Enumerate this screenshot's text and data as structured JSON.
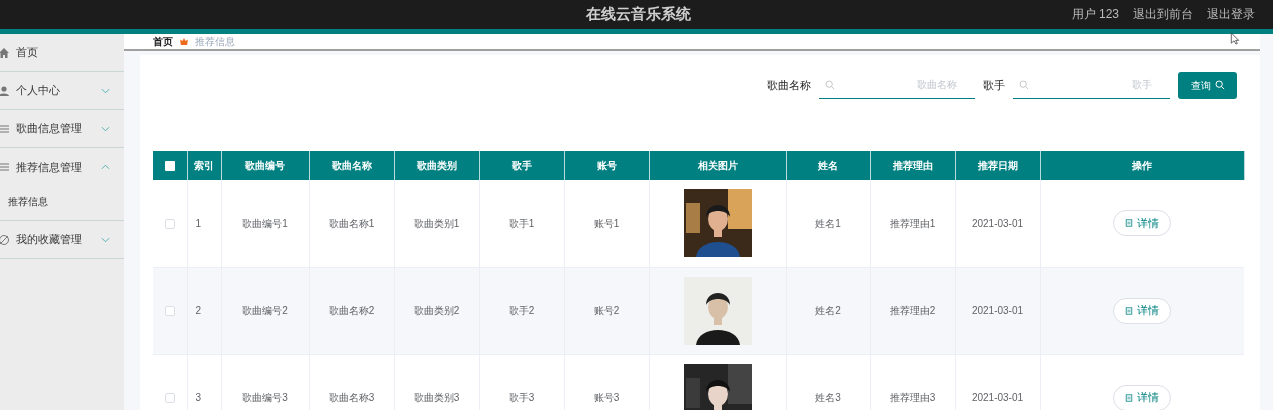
{
  "header": {
    "title": "在线云音乐系统",
    "links": [
      "用户 123",
      "退出到前台",
      "退出登录"
    ]
  },
  "sidebar": {
    "items": [
      {
        "label": "首页"
      },
      {
        "label": "个人中心",
        "expanded": false
      },
      {
        "label": "歌曲信息管理",
        "expanded": false
      },
      {
        "label": "推荐信息管理",
        "expanded": true,
        "children": [
          {
            "label": "推荐信息"
          }
        ]
      },
      {
        "label": "我的收藏管理",
        "expanded": false
      }
    ]
  },
  "breadcrumb": [
    "首页",
    "推荐信息"
  ],
  "search": {
    "fields": [
      {
        "label": "歌曲名称",
        "placeholder": "歌曲名称"
      },
      {
        "label": "歌手",
        "placeholder": "歌手"
      }
    ],
    "button": "查询"
  },
  "table": {
    "all_checked": false,
    "columns": [
      "索引",
      "歌曲编号",
      "歌曲名称",
      "歌曲类别",
      "歌手",
      "账号",
      "相关图片",
      "姓名",
      "推荐理由",
      "推荐日期",
      "操作"
    ],
    "rows": [
      {
        "checked": false,
        "cells": [
          "1",
          "歌曲编号1",
          "歌曲名称1",
          "歌曲类别1",
          "歌手1",
          "账号1"
        ],
        "cells_after": [
          "姓名1",
          "推荐理由1",
          "2021-03-01"
        ],
        "action": "详情"
      },
      {
        "checked": false,
        "cells": [
          "2",
          "歌曲编号2",
          "歌曲名称2",
          "歌曲类别2",
          "歌手2",
          "账号2"
        ],
        "cells_after": [
          "姓名2",
          "推荐理由2",
          "2021-03-01"
        ],
        "action": "详情"
      },
      {
        "checked": false,
        "cells": [
          "3",
          "歌曲编号3",
          "歌曲名称3",
          "歌曲类别3",
          "歌手3",
          "账号3"
        ],
        "cells_after": [
          "姓名3",
          "推荐理由3",
          "2021-03-01"
        ],
        "action": "详情"
      }
    ]
  }
}
